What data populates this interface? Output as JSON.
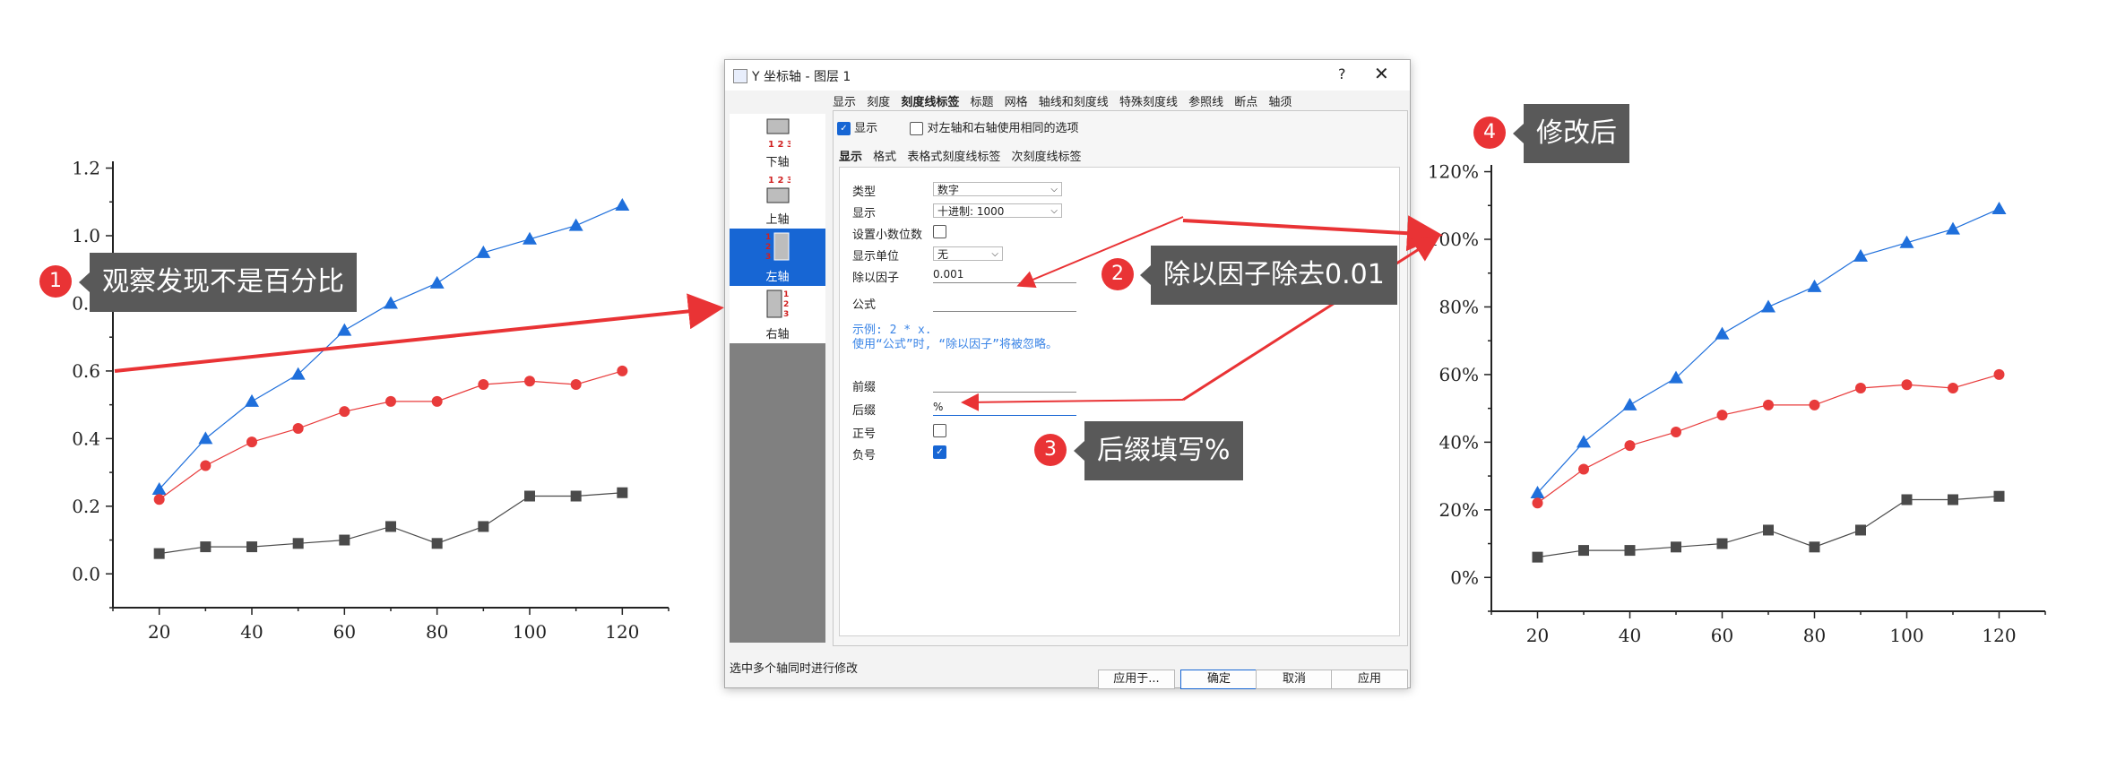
{
  "colors": {
    "series_blue": "#1f6fdb",
    "series_red": "#e83b3b",
    "series_gray": "#4a4a4a",
    "annotation_red": "#e93335",
    "callout_bg": "#595959",
    "accent": "#1766d4"
  },
  "chart_data": [
    {
      "type": "line",
      "title": "",
      "xlabel": "",
      "ylabel": "",
      "x": [
        20,
        30,
        40,
        50,
        60,
        70,
        80,
        90,
        100,
        110,
        120
      ],
      "xticks": [
        "20",
        "40",
        "60",
        "80",
        "100",
        "120"
      ],
      "yticks": [
        "0.0",
        "0.2",
        "0.4",
        "0.6",
        "0.8",
        "1.0",
        "1.2"
      ],
      "ylim": [
        -0.1,
        1.22
      ],
      "xlim": [
        10,
        130
      ],
      "grid": false,
      "series": [
        {
          "values": [
            0.25,
            0.4,
            0.51,
            0.59,
            0.72,
            0.8,
            0.86,
            0.95,
            0.99,
            1.03,
            1.09
          ],
          "marker": "triangle",
          "color": "#1f6fdb"
        },
        {
          "values": [
            0.22,
            0.32,
            0.39,
            0.43,
            0.48,
            0.51,
            0.51,
            0.56,
            0.57,
            0.56,
            0.6
          ],
          "marker": "circle",
          "color": "#e83b3b"
        },
        {
          "values": [
            0.06,
            0.08,
            0.08,
            0.09,
            0.1,
            0.14,
            0.09,
            0.14,
            0.23,
            0.23,
            0.24
          ],
          "marker": "square",
          "color": "#4a4a4a"
        }
      ]
    },
    {
      "type": "line",
      "title": "",
      "xlabel": "",
      "ylabel": "",
      "x": [
        20,
        30,
        40,
        50,
        60,
        70,
        80,
        90,
        100,
        110,
        120
      ],
      "xticks": [
        "20",
        "40",
        "60",
        "80",
        "100",
        "120"
      ],
      "yticks": [
        "0%",
        "20%",
        "40%",
        "60%",
        "80%",
        "100%",
        "120%"
      ],
      "ylim": [
        -0.1,
        1.22
      ],
      "xlim": [
        10,
        130
      ],
      "grid": false,
      "series": [
        {
          "values": [
            0.25,
            0.4,
            0.51,
            0.59,
            0.72,
            0.8,
            0.86,
            0.95,
            0.99,
            1.03,
            1.09
          ],
          "marker": "triangle",
          "color": "#1f6fdb"
        },
        {
          "values": [
            0.22,
            0.32,
            0.39,
            0.43,
            0.48,
            0.51,
            0.51,
            0.56,
            0.57,
            0.56,
            0.6
          ],
          "marker": "circle",
          "color": "#e83b3b"
        },
        {
          "values": [
            0.06,
            0.08,
            0.08,
            0.09,
            0.1,
            0.14,
            0.09,
            0.14,
            0.23,
            0.23,
            0.24
          ],
          "marker": "square",
          "color": "#4a4a4a"
        }
      ]
    }
  ],
  "dialog": {
    "title": "Y 坐标轴 - 图层 1",
    "help": "?",
    "close": "✕",
    "side_items": [
      {
        "label": "下轴",
        "icon": "bottom-axis-icon"
      },
      {
        "label": "上轴",
        "icon": "top-axis-icon"
      },
      {
        "label": "左轴",
        "icon": "left-axis-icon"
      },
      {
        "label": "右轴",
        "icon": "right-axis-icon"
      }
    ],
    "tabs": [
      "显示",
      "刻度",
      "刻度线标签",
      "标题",
      "网格",
      "轴线和刻度线",
      "特殊刻度线",
      "参照线",
      "断点",
      "轴须"
    ],
    "show_label": "显示",
    "same_options_label": "对左轴和右轴使用相同的选项",
    "subtabs": [
      "显示",
      "格式",
      "表格式刻度线标签",
      "次刻度线标签"
    ],
    "fields": {
      "type_label": "类型",
      "type_value": "数字",
      "display_label": "显示",
      "display_value": "十进制: 1000",
      "decimals_label": "设置小数位数",
      "unit_label": "显示单位",
      "unit_value": "无",
      "divide_label": "除以因子",
      "divide_value": "0.001",
      "formula_label": "公式",
      "formula_value": "",
      "prefix_label": "前缀",
      "prefix_value": "",
      "suffix_label": "后缀",
      "suffix_value": "%",
      "plus_label": "正号",
      "minus_label": "负号"
    },
    "hint_line1": "示例: 2 * x.",
    "hint_line2": "使用“公式”时, “除以因子”将被忽略。",
    "status": "选中多个轴同时进行修改",
    "buttons": {
      "apply_to": "应用于...",
      "ok": "确定",
      "cancel": "取消",
      "apply": "应用"
    }
  },
  "annotations": [
    {
      "number": "1",
      "text": "观察发现不是百分比"
    },
    {
      "number": "2",
      "text": "除以因子除去0.01"
    },
    {
      "number": "3",
      "text": "后缀填写%"
    },
    {
      "number": "4",
      "text": "修改后"
    }
  ]
}
